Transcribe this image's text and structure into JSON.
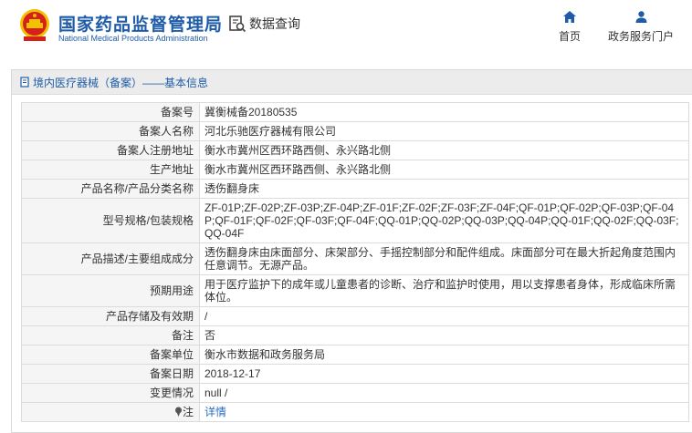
{
  "header": {
    "brand_cn": "国家药品监督管理局",
    "brand_en": "National Medical Products Administration",
    "search_label": "数据查询",
    "nav": [
      {
        "label": "首页",
        "icon": "home-icon"
      },
      {
        "label": "政务服务门户",
        "icon": "user-icon"
      }
    ]
  },
  "colors": {
    "brand": "#1f5ca8",
    "emblem_red": "#d7201b",
    "emblem_gold": "#f2c200",
    "label_bg": "#f5f5f5",
    "border": "#dcdcdc"
  },
  "breadcrumb": "境内医疗器械（备案）——基本信息",
  "rows": [
    {
      "key": "备案号",
      "value": "冀衡械备20180535"
    },
    {
      "key": "备案人名称",
      "value": "河北乐驰医疗器械有限公司"
    },
    {
      "key": "备案人注册地址",
      "value": "衡水市冀州区西环路西侧、永兴路北侧"
    },
    {
      "key": "生产地址",
      "value": "衡水市冀州区西环路西侧、永兴路北侧"
    },
    {
      "key": "产品名称/产品分类名称",
      "value": "透伤翻身床"
    },
    {
      "key": "型号规格/包装规格",
      "value": "ZF-01P;ZF-02P;ZF-03P;ZF-04P;ZF-01F;ZF-02F;ZF-03F;ZF-04F;QF-01P;QF-02P;QF-03P;QF-04P;QF-01F;QF-02F;QF-03F;QF-04F;QQ-01P;QQ-02P;QQ-03P;QQ-04P;QQ-01F;QQ-02F;QQ-03F;QQ-04F"
    },
    {
      "key": "产品描述/主要组成成分",
      "value": "透伤翻身床由床面部分、床架部分、手摇控制部分和配件组成。床面部分可在最大折起角度范围内任意调节。无源产品。"
    },
    {
      "key": "预期用途",
      "value": "用于医疗监护下的成年或儿童患者的诊断、治疗和监护时使用，用以支撑患者身体，形成临床所需体位。"
    },
    {
      "key": "产品存储及有效期",
      "value": "/"
    },
    {
      "key": "备注",
      "value": "否"
    },
    {
      "key": "备案单位",
      "value": "衡水市数据和政务服务局"
    },
    {
      "key": "备案日期",
      "value": "2018-12-17"
    },
    {
      "key": "变更情况",
      "value": "null /"
    }
  ],
  "note_row": {
    "key": "注",
    "icon": "pin-icon",
    "link": "详情"
  }
}
